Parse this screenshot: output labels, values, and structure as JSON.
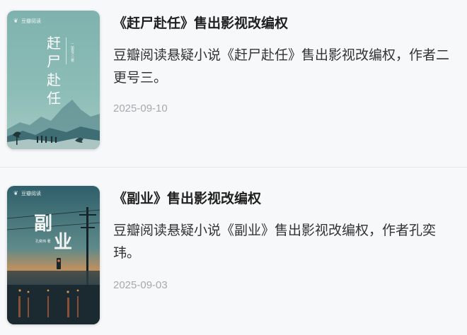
{
  "colors": {
    "background": "#f7f8f9",
    "title": "#1f1f1f",
    "summary": "#333333",
    "date": "#a7a9ac",
    "divider": "#e6e8ea"
  },
  "articles": [
    {
      "title": "《赶尸赴任》售出影视改编权",
      "summary": "豆瓣阅读悬疑小说《赶尸赴任》售出影视改编权，作者二更号三。",
      "date": "2025-09-10",
      "cover": {
        "brand": "豆瓣阅读",
        "book_title": "赶尸赴任",
        "author": "二更号三 著"
      }
    },
    {
      "title": "《副业》售出影视改编权",
      "summary": "豆瓣阅读悬疑小说《副业》售出影视改编权，作者孔奕玮。",
      "date": "2025-09-03",
      "cover": {
        "brand": "豆瓣阅读",
        "book_title": "副业",
        "author": "孔奕玮 著"
      }
    }
  ]
}
